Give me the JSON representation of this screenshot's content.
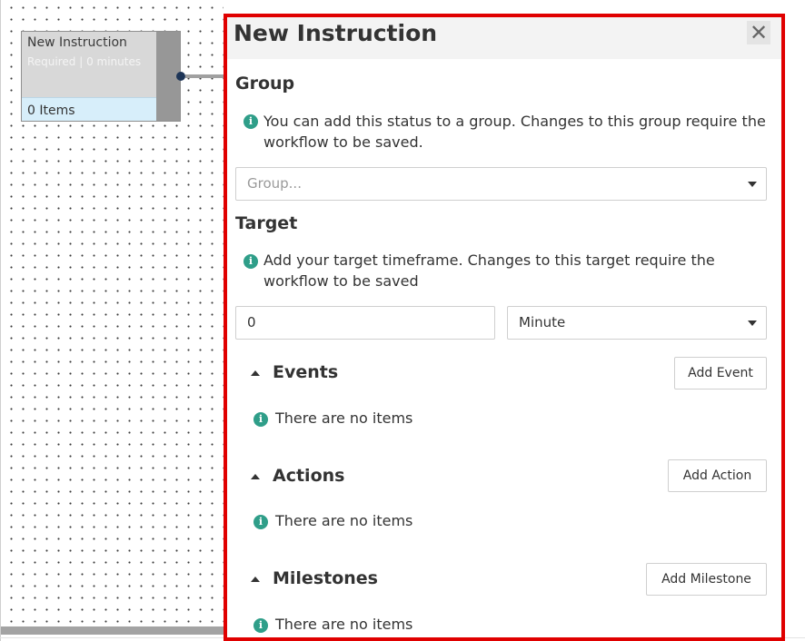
{
  "canvas": {
    "node": {
      "title": "New Instruction",
      "subtitle": "Required | 0 minutes",
      "items_count": "0 Items"
    }
  },
  "panel": {
    "title": "New Instruction",
    "close_icon": "✕",
    "group": {
      "heading": "Group",
      "info": "You can add this status to a group. Changes to this group require the workflow to be saved.",
      "placeholder": "Group..."
    },
    "target": {
      "heading": "Target",
      "info": "Add your target timeframe. Changes to this target require the workflow to be saved",
      "value": "0",
      "unit": "Minute"
    },
    "events": {
      "heading": "Events",
      "button": "Add Event",
      "empty": "There are no items"
    },
    "actions": {
      "heading": "Actions",
      "button": "Add Action",
      "empty": "There are no items"
    },
    "milestones": {
      "heading": "Milestones",
      "button": "Add Milestone",
      "empty": "There are no items"
    }
  },
  "colors": {
    "highlight_border": "#e00000",
    "info_icon": "#2f9e89",
    "node_footer": "#d7eefa"
  }
}
